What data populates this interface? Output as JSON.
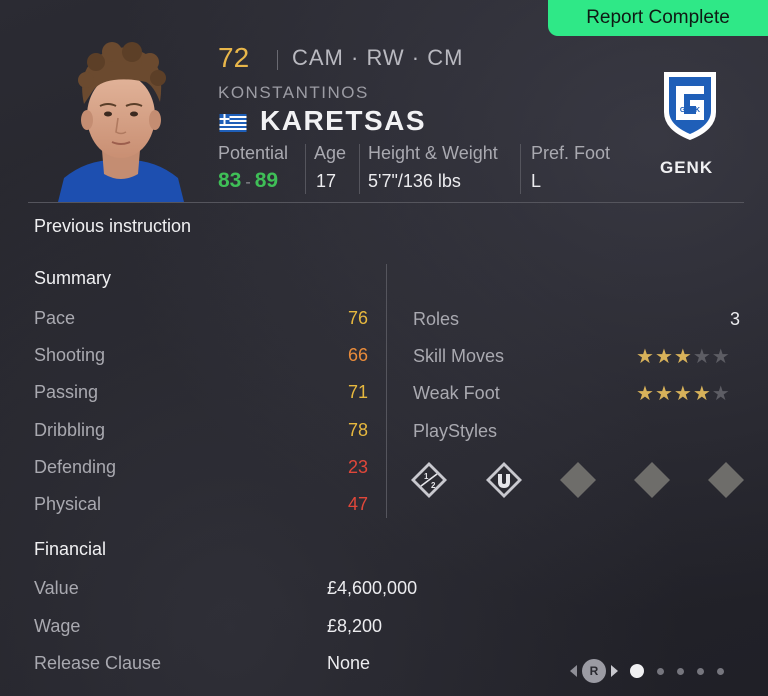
{
  "badge": {
    "label": "Report Complete"
  },
  "player": {
    "overall": "72",
    "positions": "CAM · RW · CM",
    "first_name": "KONSTANTINOS",
    "last_name": "KARETSAS",
    "nationality_flag": "greece-flag-icon",
    "info": {
      "potential_label": "Potential",
      "potential_low": "83",
      "potential_sep": "-",
      "potential_high": "89",
      "age_label": "Age",
      "age": "17",
      "hw_label": "Height & Weight",
      "hw": "5'7\"/136 lbs",
      "foot_label": "Pref. Foot",
      "foot": "L"
    },
    "club": {
      "name": "GENK",
      "crest_icon": "genk-crest-icon",
      "crest_color": "#1f5fb8"
    }
  },
  "previous_instruction": "Previous instruction",
  "summary": {
    "title": "Summary",
    "attributes": [
      {
        "label": "Pace",
        "value": "76",
        "color": "#e7b83e"
      },
      {
        "label": "Shooting",
        "value": "66",
        "color": "#e98b3a"
      },
      {
        "label": "Passing",
        "value": "71",
        "color": "#e7b83e"
      },
      {
        "label": "Dribbling",
        "value": "78",
        "color": "#e7b83e"
      },
      {
        "label": "Defending",
        "value": "23",
        "color": "#e0473a"
      },
      {
        "label": "Physical",
        "value": "47",
        "color": "#e0473a"
      }
    ],
    "roles_label": "Roles",
    "roles_value": "3",
    "skill_moves_label": "Skill Moves",
    "skill_moves_stars": 3,
    "weak_foot_label": "Weak Foot",
    "weak_foot_stars": 4,
    "max_stars": 5,
    "playstyles_label": "PlayStyles",
    "playstyles": [
      {
        "icon": "one-two-playstyle-icon",
        "unlocked": true
      },
      {
        "icon": "first-touch-playstyle-icon",
        "unlocked": true
      },
      {
        "icon": "empty-playstyle-icon",
        "unlocked": false
      },
      {
        "icon": "empty-playstyle-icon",
        "unlocked": false
      },
      {
        "icon": "empty-playstyle-icon",
        "unlocked": false
      }
    ]
  },
  "financial": {
    "title": "Financial",
    "rows": [
      {
        "label": "Value",
        "value": "£4,600,000"
      },
      {
        "label": "Wage",
        "value": "£8,200"
      },
      {
        "label": "Release Clause",
        "value": "None"
      }
    ]
  },
  "pager": {
    "button_label": "R",
    "total": 5,
    "active": 1
  },
  "colors": {
    "accent_green": "#2fe887",
    "potential_green": "#3fbf57",
    "gold": "#e8b64a",
    "star_gold": "#d8b25a"
  }
}
